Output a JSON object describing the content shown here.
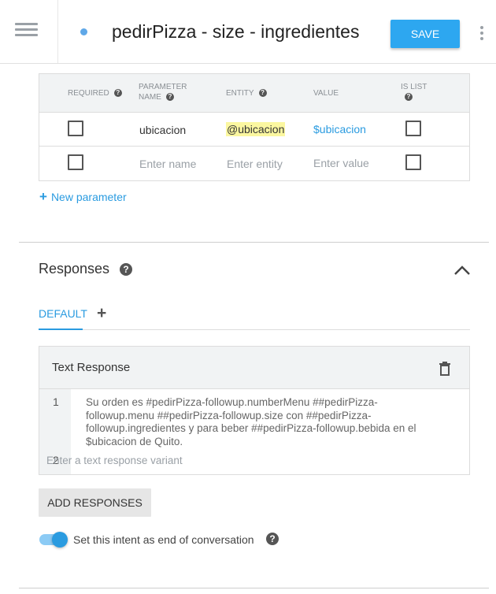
{
  "header": {
    "title": "pedirPizza - size - ingredientes",
    "save_label": "SAVE",
    "menu_icon": "hamburger-menu-icon",
    "more_icon": "more-vert-icon",
    "status_dot_color": "#5fa8e8"
  },
  "parameters": {
    "columns": {
      "required_label": "REQUIRED",
      "parameter_label_line1": "PARAMETER",
      "parameter_label_line2": "NAME",
      "entity_label": "ENTITY",
      "value_label": "VALUE",
      "is_list_label": "IS LIST"
    },
    "rows": [
      {
        "required": false,
        "name": "ubicacion",
        "entity": "@ubicacion",
        "value": "$ubicacion",
        "is_list": false
      }
    ],
    "empty_row": {
      "name_placeholder": "Enter name",
      "entity_placeholder": "Enter entity",
      "value_placeholder": "Enter value"
    },
    "new_parameter_label": "New parameter"
  },
  "responses": {
    "title": "Responses",
    "tabs": [
      {
        "label": "DEFAULT",
        "active": true
      }
    ],
    "add_tab_icon": "plus-icon",
    "text_response": {
      "title": "Text Response",
      "items": [
        {
          "number": "1",
          "text": "Su orden es #pedirPizza-followup.numberMenu ##pedirPizza-followup.menu ##pedirPizza-followup.size con  ##pedirPizza-followup.ingredientes y para beber ##pedirPizza-followup.bebida en el $ubicacion  de Quito."
        },
        {
          "number": "2",
          "placeholder": "Enter a text response variant"
        }
      ]
    },
    "add_responses_label": "ADD RESPONSES",
    "end_conversation": {
      "label": "Set this intent as end of conversation",
      "enabled": true
    }
  },
  "colors": {
    "accent": "#2a9be0",
    "save_button": "#2da7f0",
    "entity_highlight": "#fbf7a0"
  }
}
